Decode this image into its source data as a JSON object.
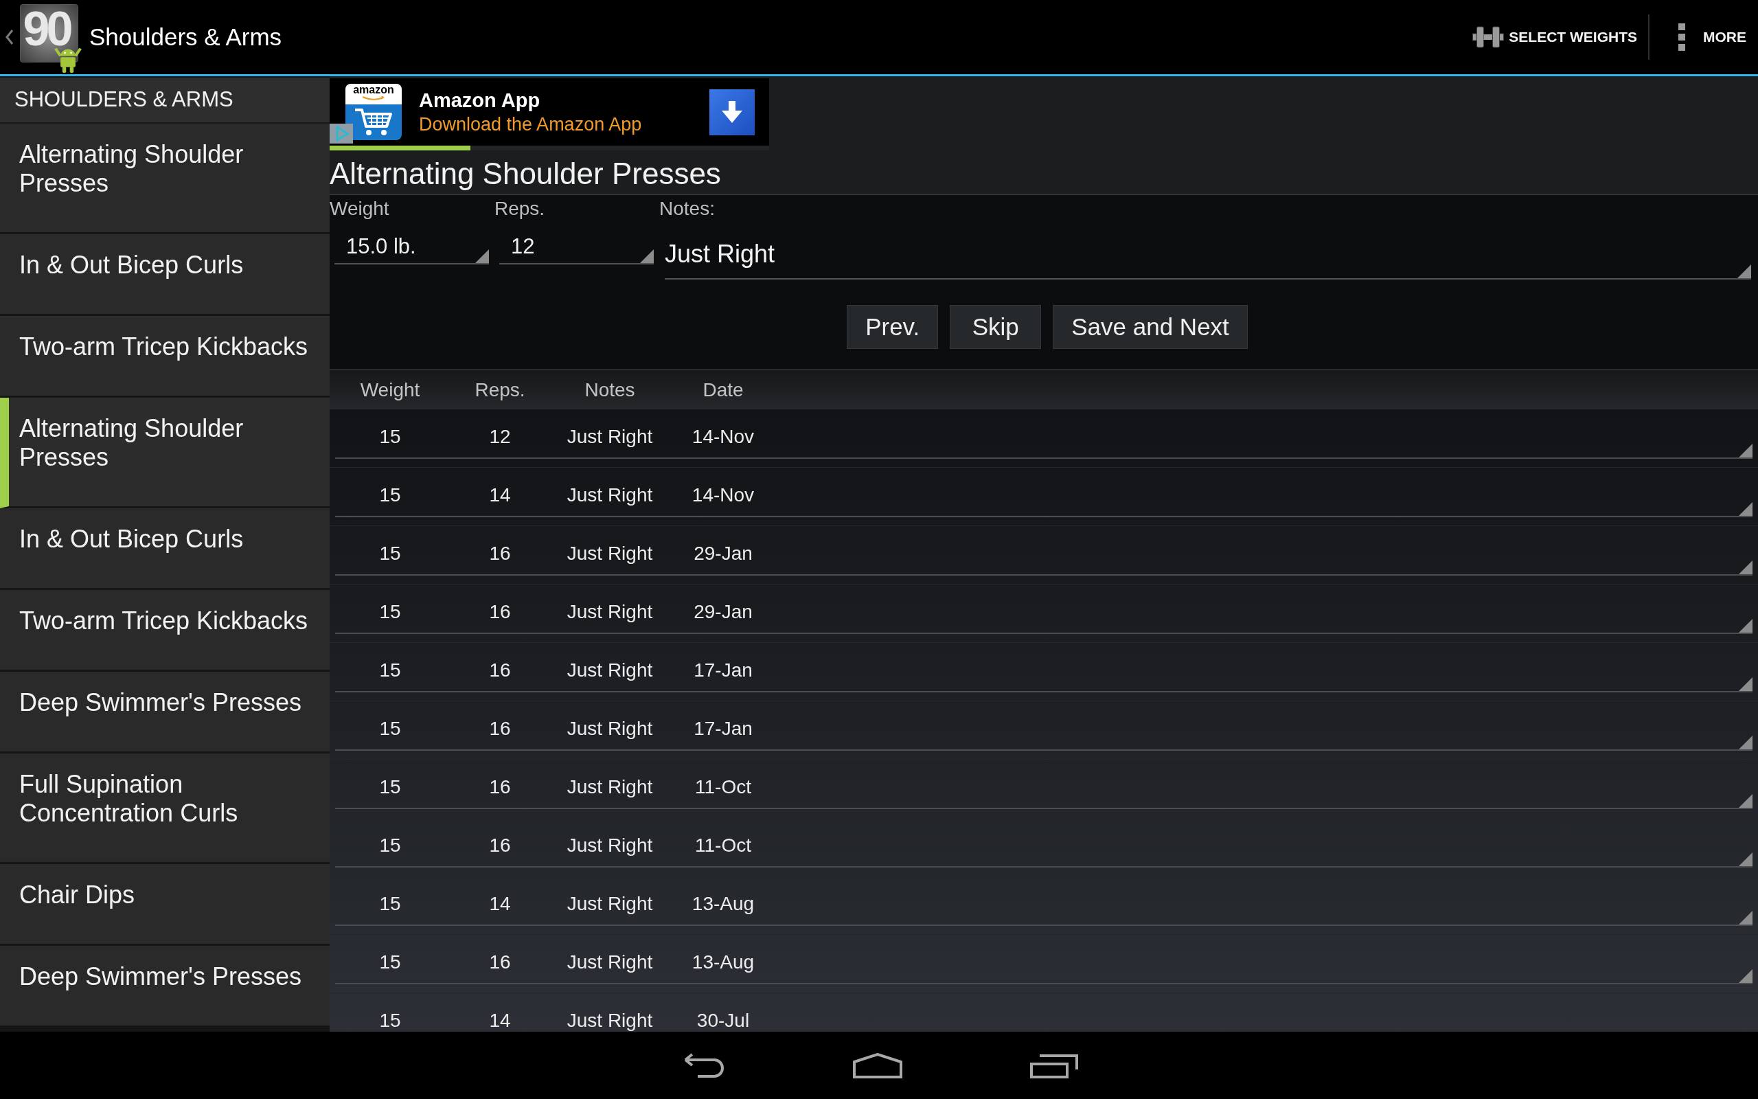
{
  "action_bar": {
    "logo_text": "90",
    "title": "Shoulders & Arms",
    "actions": [
      {
        "kind": "select_weights",
        "label": "SELECT WEIGHTS"
      },
      {
        "kind": "more",
        "label": "MORE"
      }
    ]
  },
  "sidebar": {
    "header": "SHOULDERS & ARMS",
    "items": [
      {
        "label": "Alternating Shoulder Presses",
        "selected": false
      },
      {
        "label": "In & Out Bicep Curls",
        "selected": false
      },
      {
        "label": "Two-arm Tricep Kickbacks",
        "selected": false
      },
      {
        "label": "Alternating Shoulder Presses",
        "selected": true
      },
      {
        "label": "In & Out Bicep Curls",
        "selected": false
      },
      {
        "label": "Two-arm Tricep Kickbacks",
        "selected": false
      },
      {
        "label": "Deep Swimmer's Presses",
        "selected": false
      },
      {
        "label": "Full Supination Concentration Curls",
        "selected": false
      },
      {
        "label": "Chair Dips",
        "selected": false
      },
      {
        "label": "Deep Swimmer's Presses",
        "selected": false
      }
    ]
  },
  "ad": {
    "icon_text": "amazon",
    "title": "Amazon App",
    "subtitle": "Download the Amazon App"
  },
  "workout_progress": {
    "level": 0.32
  },
  "exercise": {
    "title": "Alternating Shoulder Presses",
    "fields": [
      {
        "kind": "spinner",
        "label": "Weight",
        "value": "15.0 lb."
      },
      {
        "kind": "spinner",
        "label": "Reps.",
        "value": "12"
      },
      {
        "kind": "text",
        "label": "Notes:",
        "value": "Just Right"
      }
    ],
    "buttons": [
      "Prev.",
      "Skip",
      "Save and Next"
    ]
  },
  "history": {
    "columns": [
      "Weight",
      "Reps.",
      "Notes",
      "Date"
    ],
    "rows": [
      [
        "15",
        "12",
        "Just Right",
        "14-Nov"
      ],
      [
        "15",
        "14",
        "Just Right",
        "14-Nov"
      ],
      [
        "15",
        "16",
        "Just Right",
        "29-Jan"
      ],
      [
        "15",
        "16",
        "Just Right",
        "29-Jan"
      ],
      [
        "15",
        "16",
        "Just Right",
        "17-Jan"
      ],
      [
        "15",
        "16",
        "Just Right",
        "17-Jan"
      ],
      [
        "15",
        "16",
        "Just Right",
        "11-Oct"
      ],
      [
        "15",
        "16",
        "Just Right",
        "11-Oct"
      ],
      [
        "15",
        "14",
        "Just Right",
        "13-Aug"
      ],
      [
        "15",
        "16",
        "Just Right",
        "13-Aug"
      ],
      [
        "15",
        "14",
        "Just Right",
        "30-Jul"
      ]
    ]
  }
}
